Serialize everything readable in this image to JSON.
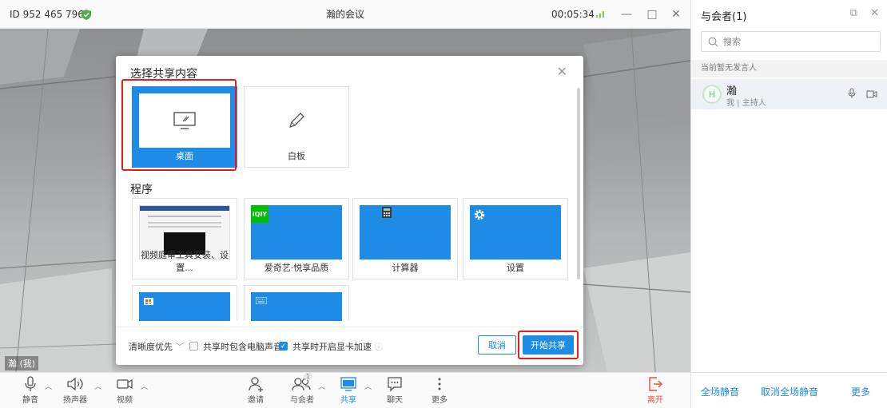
{
  "topbar": {
    "meeting_id": "ID 952 465 796",
    "title": "瀚的会议",
    "timer": "00:05:34",
    "minimize": "—",
    "maximize": "□",
    "close": "✕"
  },
  "video": {
    "self_label": "瀚 (我)"
  },
  "share_dialog": {
    "title": "选择共享内容",
    "close": "✕",
    "screens": [
      {
        "label": "桌面",
        "selected": true,
        "icon": "monitor-icon"
      },
      {
        "label": "白板",
        "selected": false,
        "icon": "pencil-icon"
      }
    ],
    "programs_title": "程序",
    "programs": [
      {
        "label": "视频庭审工具安装、设置...",
        "icon": "document-window-thumbnail"
      },
      {
        "label": "爱奇艺·悦享品质",
        "icon": "iqiyi-icon"
      },
      {
        "label": "计算器",
        "icon": "calculator-icon"
      },
      {
        "label": "设置",
        "icon": "gear-icon"
      },
      {
        "label": "",
        "icon": "store-icon"
      },
      {
        "label": "",
        "icon": "keyboard-icon"
      }
    ],
    "footer": {
      "quality": "清晰度优先",
      "include_audio": "共享时包含电脑声音",
      "include_audio_checked": false,
      "gpu_accel": "共享时开启显卡加速",
      "gpu_accel_checked": true,
      "cancel": "取消",
      "start": "开始共享"
    }
  },
  "toolbar": {
    "items": [
      {
        "label": "静音",
        "icon": "microphone-icon"
      },
      {
        "label": "扬声器",
        "icon": "speaker-icon"
      },
      {
        "label": "视频",
        "icon": "camera-icon"
      },
      {
        "label": "邀请",
        "icon": "add-user-icon"
      },
      {
        "label": "与会者",
        "icon": "participants-icon",
        "badge": "1"
      },
      {
        "label": "共享",
        "icon": "share-icon"
      },
      {
        "label": "聊天",
        "icon": "chat-icon"
      },
      {
        "label": "更多",
        "icon": "more-icon"
      },
      {
        "label": "离开",
        "icon": "leave-icon"
      }
    ]
  },
  "panel": {
    "title": "与会者(1)",
    "search_placeholder": "搜索",
    "no_speaker": "当前暂无发言人",
    "participant": {
      "avatar": "H",
      "name": "瀚",
      "role": "我 | 主持人"
    },
    "footer": {
      "mute_all": "全场静音",
      "unmute_all": "取消全场静音",
      "more": "更多"
    }
  },
  "colors": {
    "accent": "#1e8ce6",
    "highlight": "#e02020",
    "leave": "#e84a3c"
  }
}
